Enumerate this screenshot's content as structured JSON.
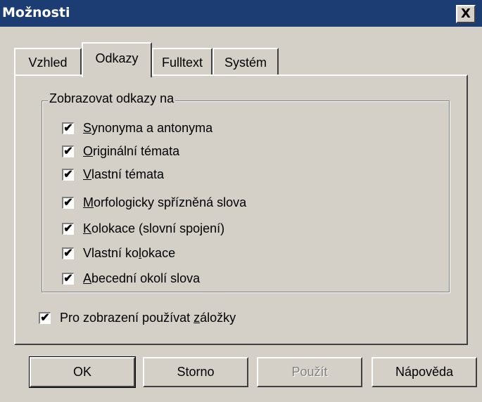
{
  "window": {
    "title": "Možnosti",
    "close_label": "X"
  },
  "tabs": [
    {
      "label": "Vzhled",
      "active": false
    },
    {
      "label": "Odkazy",
      "active": true
    },
    {
      "label": "Fulltext",
      "active": false
    },
    {
      "label": "Systém",
      "active": false
    }
  ],
  "group": {
    "label": "Zobrazovat odkazy na",
    "items": [
      {
        "pre": "",
        "u": "S",
        "post": "ynonyma a antonyma",
        "checked": true
      },
      {
        "pre": "",
        "u": "O",
        "post": "riginální témata",
        "checked": true
      },
      {
        "pre": "",
        "u": "V",
        "post": "lastní témata",
        "checked": true
      },
      {
        "pre": "",
        "u": "M",
        "post": "orfologicky spřízněná slova",
        "checked": true
      },
      {
        "pre": "",
        "u": "K",
        "post": "olokace (slovní spojení)",
        "checked": true
      },
      {
        "pre": "Vlastní ko",
        "u": "l",
        "post": "okace",
        "checked": true
      },
      {
        "pre": "",
        "u": "A",
        "post": "becední okolí slova",
        "checked": true
      }
    ]
  },
  "option": {
    "pre": "Pro zobrazení používat ",
    "u": "z",
    "post": "áložky",
    "checked": true
  },
  "checkmark": "✔",
  "buttons": {
    "ok": "OK",
    "cancel": "Storno",
    "apply": "Použít",
    "help": "Nápověda"
  }
}
